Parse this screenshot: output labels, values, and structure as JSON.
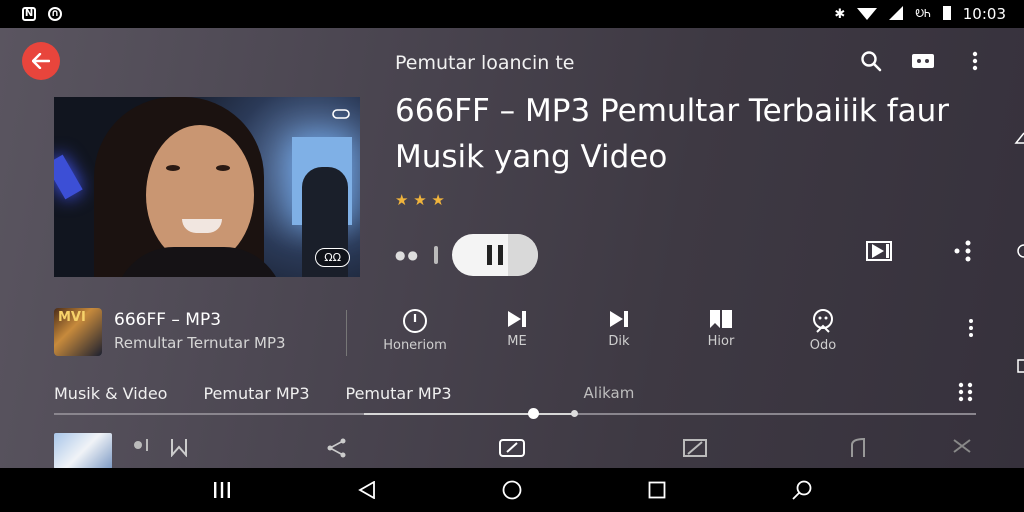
{
  "status_bar": {
    "time": "10:03",
    "carrier_text": "ᎧᏂ",
    "left_icons": [
      "notification-icon",
      "app-icon"
    ]
  },
  "header": {
    "title": "Pemutar loancin te",
    "back_icon": "back-arrow-icon",
    "icons": [
      "search-icon",
      "cast-icon",
      "more-vert-icon"
    ]
  },
  "thumbnail": {
    "badge": "ΩΩ"
  },
  "main": {
    "title": "666FF – MP3 Pemultar Terbaiiik faur Musik yang Video",
    "stars": "★ ★ ★"
  },
  "track": {
    "title": "666FF – MP3",
    "subtitle": "Remultar Ternutar MP3",
    "art_text": "MVI"
  },
  "actions": [
    {
      "label": "Honeriom",
      "icon": "timer-icon"
    },
    {
      "label": "ME",
      "icon": "skip-next-icon"
    },
    {
      "label": "Dik",
      "icon": "skip-next-icon"
    },
    {
      "label": "Hior",
      "icon": "bookmark-icon"
    },
    {
      "label": "Odo",
      "icon": "profile-icon"
    }
  ],
  "tabs": [
    "Musik & Video",
    "Pemutar MP3",
    "Pemutar MP3",
    "Alikam"
  ],
  "colors": {
    "accent": "#e8453c",
    "star": "#f0b43c"
  }
}
